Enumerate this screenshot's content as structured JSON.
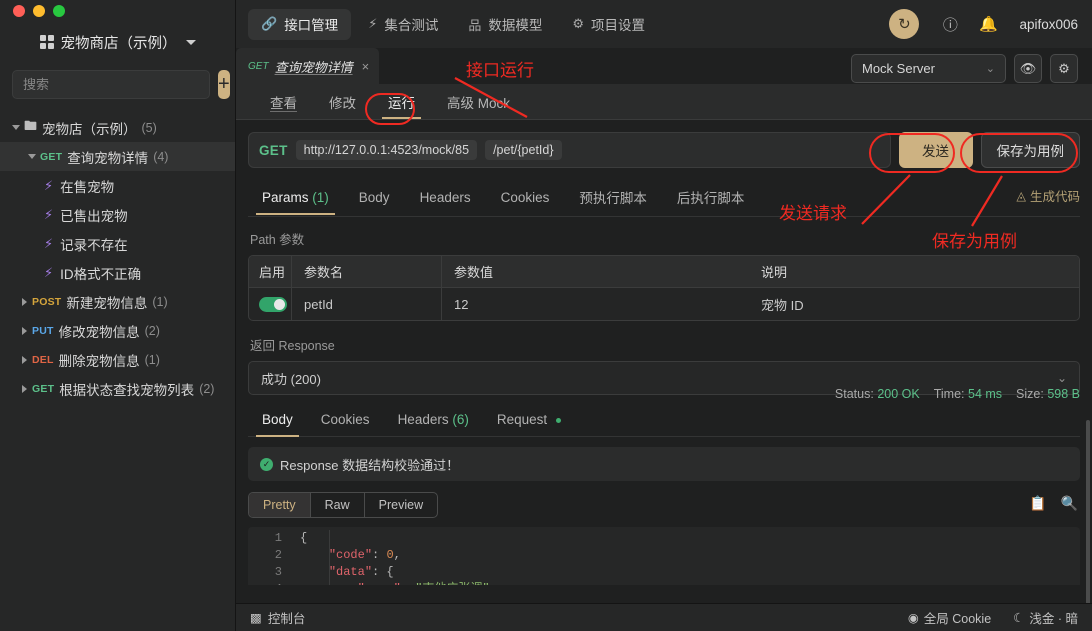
{
  "sidebar": {
    "project": {
      "name": "宠物商店（示例）",
      "icon": "grid-icon"
    },
    "search": {
      "placeholder": "搜索",
      "value": ""
    },
    "add_label": "+",
    "tree": [
      {
        "kind": "folder",
        "label": "宠物店（示例）",
        "count": "(5)",
        "indent": 0,
        "open": true,
        "selected": false
      },
      {
        "kind": "api",
        "method": "GET",
        "method_class": "m-get",
        "label": "查询宠物详情",
        "count": "(4)",
        "indent": 1,
        "open": true,
        "selected": true
      },
      {
        "kind": "case",
        "label": "在售宠物",
        "indent": 2,
        "selected": false
      },
      {
        "kind": "case",
        "label": "已售出宠物",
        "indent": 2,
        "selected": false
      },
      {
        "kind": "case",
        "label": "记录不存在",
        "indent": 2,
        "selected": false
      },
      {
        "kind": "case",
        "label": "ID格式不正确",
        "indent": 2,
        "selected": false
      },
      {
        "kind": "api",
        "method": "POST",
        "method_class": "m-post",
        "label": "新建宠物信息",
        "count": "(1)",
        "indent": 1,
        "open": false,
        "selected": false
      },
      {
        "kind": "api",
        "method": "PUT",
        "method_class": "m-put",
        "label": "修改宠物信息",
        "count": "(2)",
        "indent": 1,
        "open": false,
        "selected": false
      },
      {
        "kind": "api",
        "method": "DEL",
        "method_class": "m-del",
        "label": "删除宠物信息",
        "count": "(1)",
        "indent": 1,
        "open": false,
        "selected": false
      },
      {
        "kind": "api",
        "method": "GET",
        "method_class": "m-get",
        "label": "根据状态查找宠物列表",
        "count": "(2)",
        "indent": 1,
        "open": false,
        "selected": false
      }
    ]
  },
  "topbar": {
    "nav": [
      {
        "label": "接口管理",
        "icon": "link-icon",
        "glyph": "⚓",
        "active": true
      },
      {
        "label": "集合测试",
        "icon": "bolt-icon",
        "glyph": "⚡",
        "active": false
      },
      {
        "label": "数据模型",
        "icon": "model-icon",
        "glyph": "品",
        "active": false
      },
      {
        "label": "项目设置",
        "icon": "gear-icon",
        "glyph": "⚙",
        "active": false
      }
    ],
    "sync_icon": "refresh-icon",
    "help_icon": "help-circle-icon",
    "bell_icon": "bell-icon",
    "user": "apifox006",
    "env_select": "Mock Server",
    "eye_icon": "eye-icon",
    "settings_icon": "gear-icon"
  },
  "doc_tab": {
    "method": "GET",
    "title": "查询宠物详情",
    "close": "×"
  },
  "subtabs": [
    {
      "label": "查看",
      "active": false
    },
    {
      "label": "修改",
      "active": false
    },
    {
      "label": "运行",
      "active": true
    },
    {
      "label": "高级 Mock",
      "active": false
    }
  ],
  "request": {
    "method": "GET",
    "host": "http://127.0.0.1:4523/mock/85",
    "path": "/pet/{petId}",
    "send_label": "发送",
    "save_case_label": "保存为用例",
    "tabs": [
      {
        "label": "Params",
        "count": "(1)",
        "active": true
      },
      {
        "label": "Body",
        "count": "",
        "active": false
      },
      {
        "label": "Headers",
        "count": "",
        "active": false
      },
      {
        "label": "Cookies",
        "count": "",
        "active": false
      },
      {
        "label": "预执行脚本",
        "count": "",
        "active": false
      },
      {
        "label": "后执行脚本",
        "count": "",
        "active": false
      }
    ],
    "gen_code_label": "生成代码",
    "path_params_label": "Path 参数",
    "table": {
      "headers": [
        "启用",
        "参数名",
        "参数值",
        "说明"
      ],
      "rows": [
        {
          "enabled": true,
          "name": "petId",
          "value": "12",
          "desc": "宠物 ID"
        }
      ]
    }
  },
  "response": {
    "section_label": "返回 Response",
    "selected_status": "成功 (200)",
    "tabs": [
      {
        "label": "Body",
        "count": "",
        "dot": false,
        "active": true
      },
      {
        "label": "Cookies",
        "count": "",
        "dot": false,
        "active": false
      },
      {
        "label": "Headers",
        "count": "(6)",
        "dot": false,
        "active": false
      },
      {
        "label": "Request",
        "count": "",
        "dot": true,
        "active": false
      }
    ],
    "stats": [
      {
        "label": "Status:",
        "value": "200 OK"
      },
      {
        "label": "Time:",
        "value": "54 ms"
      },
      {
        "label": "Size:",
        "value": "598 B"
      }
    ],
    "validation_text": "Response 数据结构校验通过！",
    "formats": [
      {
        "label": "Pretty",
        "active": true
      },
      {
        "label": "Raw",
        "active": false
      },
      {
        "label": "Preview",
        "active": false
      }
    ],
    "copy_icon": "copy-icon",
    "search_icon": "search-icon",
    "code_lines": [
      {
        "num": "1",
        "fold": true,
        "text": "{"
      },
      {
        "num": "2",
        "fold": false,
        "text": "    \"code\": 0,"
      },
      {
        "num": "3",
        "fold": true,
        "text": "    \"data\": {"
      },
      {
        "num": "4",
        "fold": false,
        "text": "        \"name\": \"吉他广张调\""
      }
    ]
  },
  "statusbar": {
    "console_label": "控制台",
    "console_icon": "terminal-icon",
    "cookie_label": "全局 Cookie",
    "cookie_icon": "cookie-icon",
    "theme_label": "浅金 · 暗",
    "theme_icon": "moon-icon"
  },
  "annotations": [
    {
      "id": "run-tab",
      "text": "接口运行"
    },
    {
      "id": "send",
      "text": "发送请求"
    },
    {
      "id": "save-case",
      "text": "保存为用例"
    }
  ],
  "colors": {
    "accent": "#cdb282",
    "annotation": "#ef2a22",
    "method_get": "#5cc08a",
    "method_post": "#d5a53c",
    "method_put": "#5aa7e8",
    "method_del": "#e06545",
    "success": "#3fae6f"
  }
}
